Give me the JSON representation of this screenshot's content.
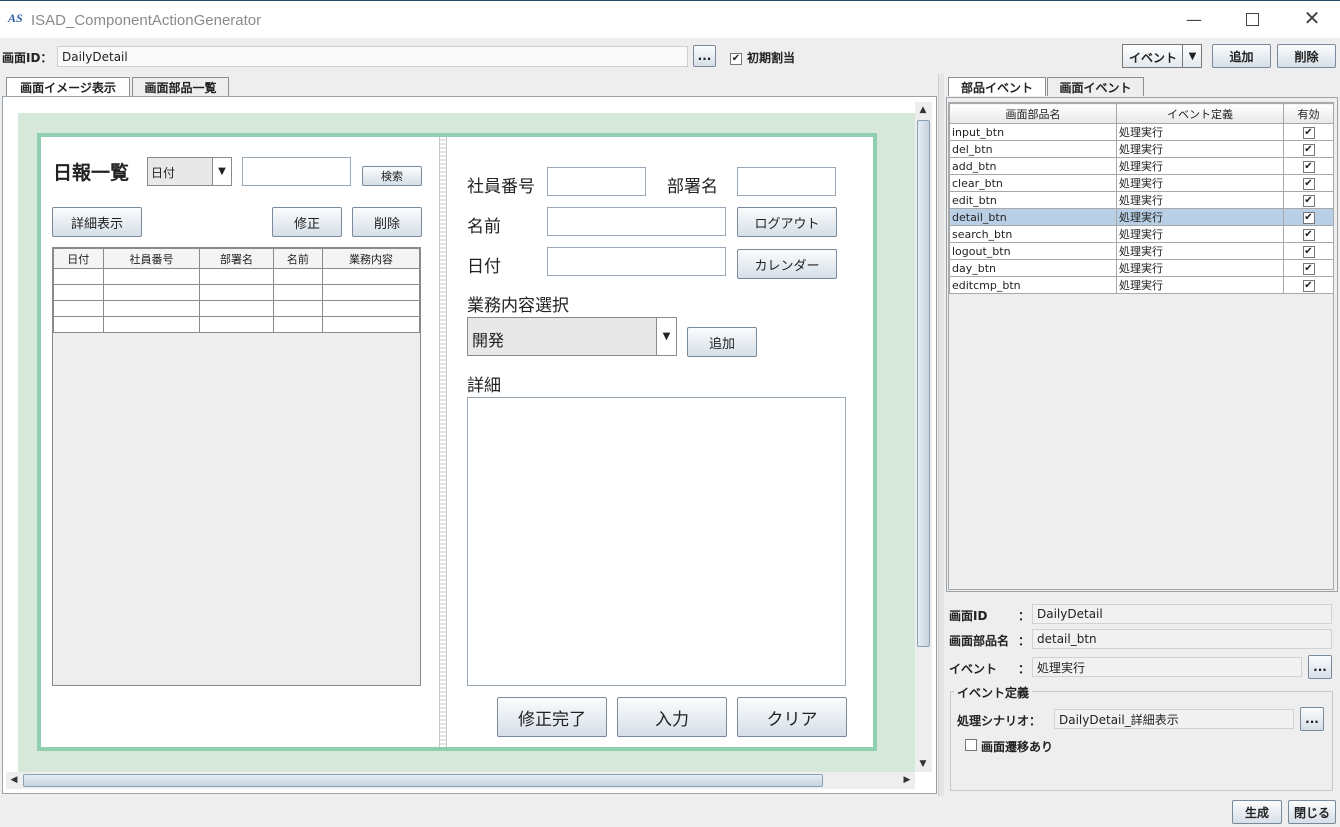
{
  "window": {
    "title": "ISAD_ComponentActionGenerator"
  },
  "toolbar": {
    "screen_id_label": "画面ID：",
    "screen_id_value": "DailyDetail",
    "browse_label": "...",
    "initial_assign_label": "初期割当",
    "initial_assign_checked": "✔",
    "event_select_value": "イベント",
    "add_label": "追加",
    "delete_label": "削除"
  },
  "left_tabs": [
    "画面イメージ表示",
    "画面部品一覧"
  ],
  "preview": {
    "left": {
      "title": "日報一覧",
      "date_select": "日付",
      "search_label": "検索",
      "detail_label": "詳細表示",
      "edit_label": "修正",
      "delete_label": "削除",
      "table_headers": [
        "日付",
        "社員番号",
        "部署名",
        "名前",
        "業務内容"
      ]
    },
    "right": {
      "employee_no_label": "社員番号",
      "dept_label": "部署名",
      "name_label": "名前",
      "logout_label": "ログアウト",
      "date_label": "日付",
      "calendar_label": "カレンダー",
      "task_select_label": "業務内容選択",
      "task_value": "開発",
      "add_label": "追加",
      "detail_label": "詳細",
      "edit_done_label": "修正完了",
      "input_label": "入力",
      "clear_label": "クリア"
    }
  },
  "right_tabs": [
    "部品イベント",
    "画面イベント"
  ],
  "event_table": {
    "headers": [
      "画面部品名",
      "イベント定義",
      "有効"
    ],
    "rows": [
      {
        "name": "input_btn",
        "event": "処理実行",
        "enabled": "✔"
      },
      {
        "name": "del_btn",
        "event": "処理実行",
        "enabled": "✔"
      },
      {
        "name": "add_btn",
        "event": "処理実行",
        "enabled": "✔"
      },
      {
        "name": "clear_btn",
        "event": "処理実行",
        "enabled": "✔"
      },
      {
        "name": "edit_btn",
        "event": "処理実行",
        "enabled": "✔"
      },
      {
        "name": "detail_btn",
        "event": "処理実行",
        "enabled": "✔"
      },
      {
        "name": "search_btn",
        "event": "処理実行",
        "enabled": "✔"
      },
      {
        "name": "logout_btn",
        "event": "処理実行",
        "enabled": "✔"
      },
      {
        "name": "day_btn",
        "event": "処理実行",
        "enabled": "✔"
      },
      {
        "name": "editcmp_btn",
        "event": "処理実行",
        "enabled": "✔"
      }
    ],
    "selected_index": 5
  },
  "details": {
    "screen_id_label": "画面ID",
    "screen_id_value": "DailyDetail",
    "part_name_label": "画面部品名",
    "part_name_value": "detail_btn",
    "event_label": "イベント",
    "event_value": "処理実行",
    "colon": "：",
    "browse_label": "...",
    "group_label": "イベント定義",
    "scenario_label": "処理シナリオ：",
    "scenario_value": "DailyDetail_詳細表示",
    "transition_label": "画面遷移あり"
  },
  "footer": {
    "generate_label": "生成",
    "close_label": "閉じる"
  },
  "colors": {
    "accent": "#c8d8e8",
    "preview_bg": "#d5e8da",
    "preview_border": "#8fcfad",
    "selected_row": "#b8cfe5"
  }
}
